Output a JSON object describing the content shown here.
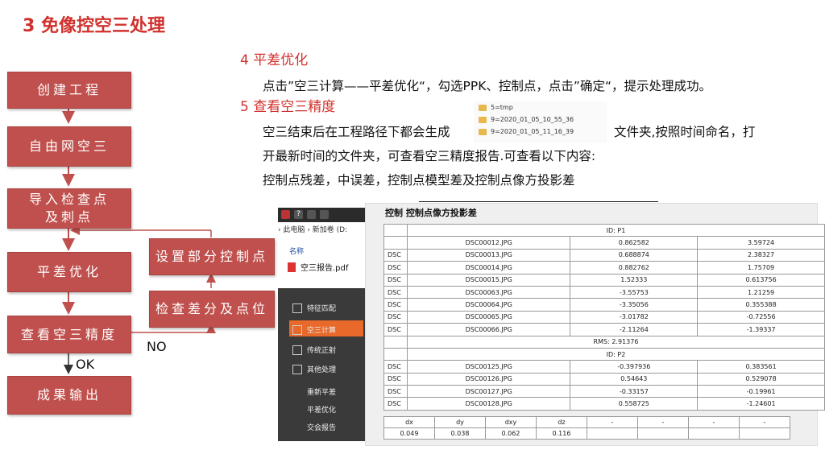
{
  "title": "3  免像控空三处理",
  "flowchart": {
    "boxes": [
      "创建工程",
      "自由网空三",
      "导入检查点及刺点",
      "平差优化",
      "查看空三精度",
      "成果输出",
      "设置部分控制点",
      "检查差分及点位"
    ],
    "box_lines": {
      "b2a": "导入检查点",
      "b2b": "及刺点"
    },
    "labels": {
      "ok": "OK",
      "no": "NO"
    }
  },
  "section4": {
    "heading": "4 平差优化",
    "text": "点击”空三计算——平差优化“，勾选PPK、控制点，点击”确定“，提示处理成功。"
  },
  "section5": {
    "heading": "5 查看空三精度",
    "line1a": "空三结束后在工程路径下都会生成",
    "line1b": "文件夹,按照时间命名，打",
    "line2": "开最新时间的文件夹，可查看空三精度报告.可查看以下内容:",
    "line3": "控制点残差，中误差，控制点模型差及控制点像方投影差"
  },
  "folders": [
    "5=tmp",
    "9=2020_01_05_10_55_36",
    "9=2020_01_05_11_16_39"
  ],
  "explorer": {
    "breadcrumb": "› 此电脑 › 新加卷 (D:",
    "name_header": "名称",
    "file": "空三报告.pdf",
    "menu": [
      "特征匹配",
      "空三计算",
      "传统正射",
      "其他处理",
      "重新平差",
      "平差优化",
      "交会报告"
    ]
  },
  "table": {
    "title": "控制 控制点像方投影差",
    "rows": [
      {
        "type": "header",
        "text": "ID: P1"
      },
      {
        "type": "row",
        "prefix": "",
        "name": "DSC00012.JPG",
        "v1": "0.862582",
        "v2": "3.59724"
      },
      {
        "type": "row",
        "prefix": "DSC",
        "name": "DSC00013.JPG",
        "v1": "0.688874",
        "v2": "2.38327"
      },
      {
        "type": "row",
        "prefix": "DSC",
        "name": "DSC00014.JPG",
        "v1": "0.882762",
        "v2": "1.75709"
      },
      {
        "type": "row",
        "prefix": "DSC",
        "name": "DSC00015.JPG",
        "v1": "1.52333",
        "v2": "0.613756"
      },
      {
        "type": "row",
        "prefix": "DSC",
        "name": "DSC00063.JPG",
        "v1": "-3.55753",
        "v2": "1.21259"
      },
      {
        "type": "row",
        "prefix": "DSC",
        "name": "DSC00064.JPG",
        "v1": "-3.35056",
        "v2": "0.355388"
      },
      {
        "type": "row",
        "prefix": "DSC",
        "name": "DSC00065.JPG",
        "v1": "-3.01782",
        "v2": "-0.72556"
      },
      {
        "type": "row",
        "prefix": "DSC",
        "name": "DSC00066.JPG",
        "v1": "-2.11264",
        "v2": "-1.39337"
      },
      {
        "type": "header",
        "text": "RMS: 2.91376"
      },
      {
        "type": "header",
        "text": "ID: P2"
      },
      {
        "type": "row",
        "prefix": "DSC",
        "name": "DSC00125.JPG",
        "v1": "-0.397936",
        "v2": "0.383561"
      },
      {
        "type": "row",
        "prefix": "DSC",
        "name": "DSC00126.JPG",
        "v1": "0.54643",
        "v2": "0.529078"
      },
      {
        "type": "row",
        "prefix": "DSC",
        "name": "DSC00127.JPG",
        "v1": "-0.33157",
        "v2": "-0.19961"
      },
      {
        "type": "row",
        "prefix": "DSC",
        "name": "DSC00128.JPG",
        "v1": "0.558725",
        "v2": "-1.24601"
      }
    ],
    "bottom_headers": [
      "dx",
      "dy",
      "dxy",
      "dz",
      "-",
      "-",
      "-",
      "-"
    ],
    "bottom_values": [
      "0.049",
      "0.038",
      "0.062",
      "0.116",
      "",
      "",
      "",
      ""
    ]
  }
}
